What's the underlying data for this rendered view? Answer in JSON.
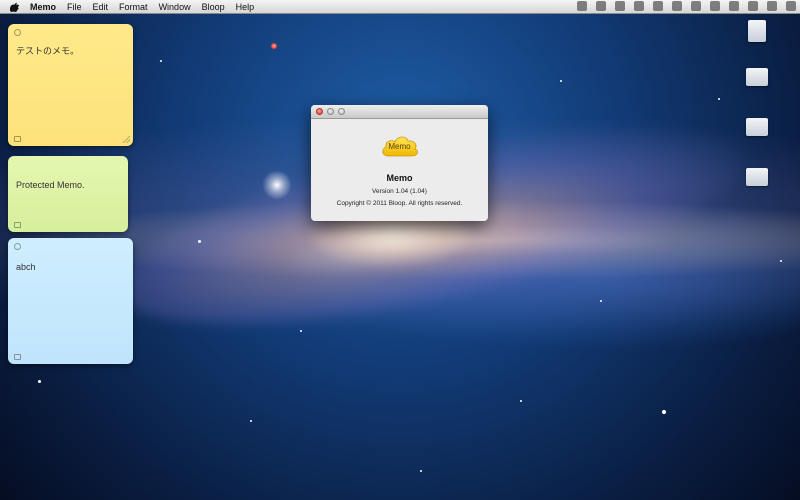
{
  "menubar": {
    "app_name": "Memo",
    "items": [
      "File",
      "Edit",
      "Format",
      "Window",
      "Bloop",
      "Help"
    ]
  },
  "notes": [
    {
      "text": "テストのメモ。",
      "color": "#fde27a"
    },
    {
      "text": "Protected Memo.",
      "color": "#d6ef9c"
    },
    {
      "text": "abch",
      "color": "#bfe4fb"
    }
  ],
  "about": {
    "logo_text": "Memo",
    "title": "Memo",
    "version": "Version 1.04 (1.04)",
    "copyright": "Copyright © 2011 Bloop. All rights reserved."
  },
  "colors": {
    "logo_yellow": "#f6c81a",
    "close_button": "#e0443a",
    "menubar_bg": "#e6e6e6"
  }
}
